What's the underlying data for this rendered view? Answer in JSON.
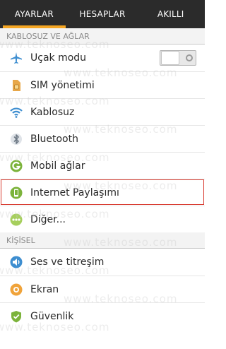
{
  "tabs": [
    {
      "label": "AYARLAR",
      "active": true
    },
    {
      "label": "HESAPLAR",
      "active": false
    },
    {
      "label": "AKILLI",
      "active": false
    }
  ],
  "sections": {
    "wireless": "KABLOSUZ VE AĞLAR",
    "personal": "KİŞİSEL"
  },
  "items": {
    "airplane": {
      "label": "Uçak modu",
      "icon": "airplane-icon"
    },
    "sim": {
      "label": "SIM yönetimi",
      "icon": "sim-card-icon"
    },
    "wifi": {
      "label": "Kablosuz",
      "icon": "wifi-icon"
    },
    "bluetooth": {
      "label": "Bluetooth",
      "icon": "bluetooth-icon"
    },
    "mobile": {
      "label": "Mobil ağlar",
      "icon": "mobile-network-icon"
    },
    "tethering": {
      "label": "Internet Paylaşımı",
      "icon": "tethering-icon"
    },
    "more": {
      "label": "Diğer...",
      "icon": "more-dots-icon"
    },
    "sound": {
      "label": "Ses ve titreşim",
      "icon": "speaker-icon"
    },
    "display": {
      "label": "Ekran",
      "icon": "brightness-icon"
    },
    "security": {
      "label": "Güvenlik",
      "icon": "shield-icon"
    }
  },
  "airplane_toggle": {
    "on": false
  },
  "watermark": "www.teknoseo.com",
  "colors": {
    "tab_background": "#2b2b2b",
    "tab_indicator": "#f5a623",
    "highlight_border": "#d8382d",
    "icon_blue": "#3e8ed0",
    "icon_green": "#7cb33b"
  }
}
